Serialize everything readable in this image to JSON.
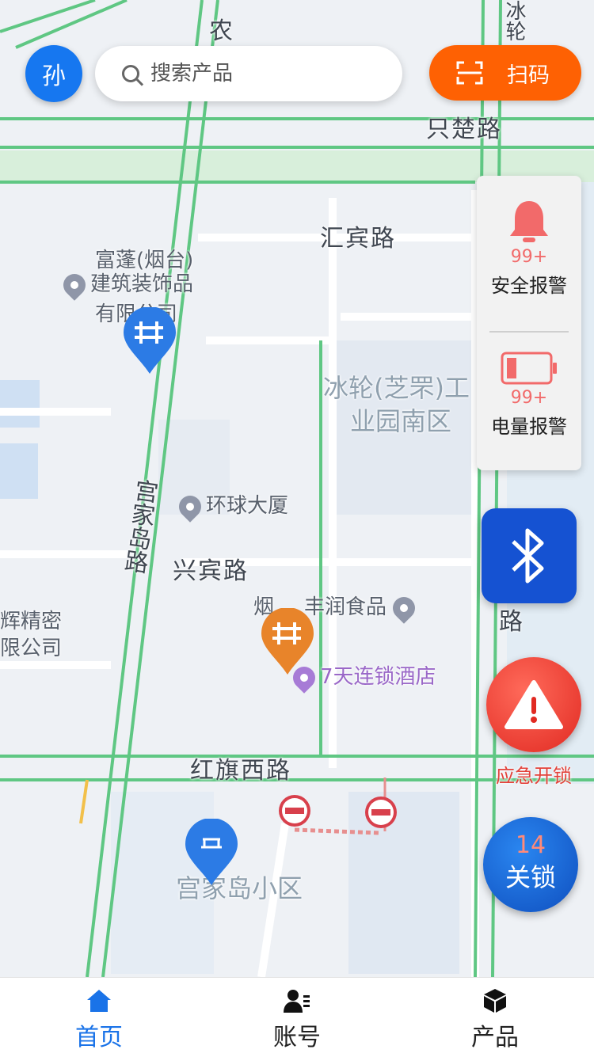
{
  "header": {
    "avatar_text": "孙",
    "search_placeholder": "搜索产品",
    "scan_label": "扫码"
  },
  "map": {
    "roads": [
      "只楚路",
      "汇宾路",
      "兴宾路",
      "红旗西路",
      "宫家岛路",
      "农",
      "冰轮",
      "路"
    ],
    "pois": [
      "富蓬(烟台)",
      "建筑装饰品",
      "有限公司",
      "环球大厦",
      "丰润食品",
      "7天连锁酒店",
      "烟",
      "辉精密",
      "限公司"
    ],
    "areas": [
      "冰轮(芝罘)工",
      "业园南区",
      "宫家岛小区"
    ]
  },
  "alarms": [
    {
      "count": "99+",
      "label": "安全报警",
      "icon": "bell-icon"
    },
    {
      "count": "99+",
      "label": "电量报警",
      "icon": "battery-low-icon"
    }
  ],
  "actions": {
    "bluetooth_icon": "bluetooth-icon",
    "emergency_label": "应急开锁",
    "lock_count": "14",
    "lock_label": "关锁"
  },
  "tabs": [
    {
      "label": "首页",
      "icon": "home-icon",
      "active": true
    },
    {
      "label": "账号",
      "icon": "account-icon",
      "active": false
    },
    {
      "label": "产品",
      "icon": "product-box-icon",
      "active": false
    }
  ],
  "colors": {
    "primary": "#1677f0",
    "scan": "#fe6103",
    "alarm": "#f26a6a",
    "emergency": "#e12a22",
    "road": "#5fc783"
  }
}
